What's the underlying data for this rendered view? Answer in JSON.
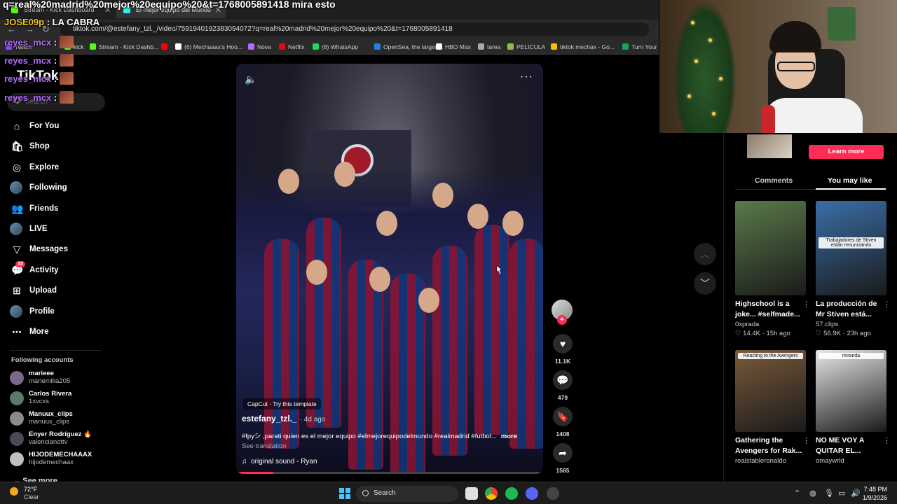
{
  "browser": {
    "tabs": [
      {
        "label": "Stream - Kick Dashboard",
        "color": "#53fc18"
      },
      {
        "label": "El mejor equipo del Mundo",
        "color": "#25f4ee"
      }
    ],
    "url": "tiktok.com/@estefany_tzl._/video/7591940192383094072?q=real%20madrid%20mejor%20equipo%20&t=1768005891418",
    "bookmarks": [
      {
        "label": "Twitch",
        "color": "#9146ff"
      },
      {
        "label": "kick",
        "color": "#53fc18"
      },
      {
        "label": "Stream - Kick Dashb...",
        "color": "#53fc18"
      },
      {
        "label": "",
        "color": "#ff0000"
      },
      {
        "label": "(6) Mechaaax's Hoo...",
        "color": "#ffffff"
      },
      {
        "label": "Nova",
        "color": "#b36bff"
      },
      {
        "label": "Netflix",
        "color": "#e50914"
      },
      {
        "label": "(8) WhatsApp",
        "color": "#25d366"
      },
      {
        "label": "OpenSea, the larges...",
        "color": "#2081e2"
      },
      {
        "label": "HBO Max",
        "color": "#ffffff"
      },
      {
        "label": "tarea",
        "color": "#aaaaaa"
      },
      {
        "label": "PELICULA",
        "color": "#8bc34a"
      },
      {
        "label": "tiktok mechax - Go...",
        "color": "#fbbc04"
      },
      {
        "label": "Turn Your S",
        "color": "#0fa958"
      }
    ]
  },
  "overlay": {
    "title": "q=real%20madrid%20mejor%20equipo%20&t=1768005891418 mira esto",
    "chat": [
      {
        "user": "JOSE09p",
        "msg": ": LA CABRA",
        "gold": true
      },
      {
        "user": "reyes_mcx",
        "msg": ":",
        "gold": false
      },
      {
        "user": "reyes_mcx",
        "msg": ":",
        "gold": false
      },
      {
        "user": "reyes_mcx",
        "msg": ":",
        "gold": false
      },
      {
        "user": "reyes_mcx",
        "msg": ":",
        "gold": false
      }
    ]
  },
  "tiktok": {
    "logo": "TikTok",
    "search_placeholder": "Search",
    "nav": [
      {
        "label": "For You",
        "icon": "home-icon",
        "glyph": "⌂"
      },
      {
        "label": "Shop",
        "icon": "shop-icon",
        "glyph": "🛍"
      },
      {
        "label": "Explore",
        "icon": "compass-icon",
        "glyph": "◎"
      },
      {
        "label": "Following",
        "icon": "following-avatar-icon",
        "glyph": ""
      },
      {
        "label": "Friends",
        "icon": "friends-icon",
        "glyph": "👥"
      },
      {
        "label": "LIVE",
        "icon": "live-avatar-icon",
        "glyph": ""
      },
      {
        "label": "Messages",
        "icon": "messages-icon",
        "glyph": "▽"
      },
      {
        "label": "Activity",
        "icon": "activity-icon",
        "glyph": "💬",
        "badge": "33"
      },
      {
        "label": "Upload",
        "icon": "upload-icon",
        "glyph": "⊞"
      },
      {
        "label": "Profile",
        "icon": "profile-avatar-icon",
        "glyph": ""
      },
      {
        "label": "More",
        "icon": "more-icon",
        "glyph": "⋯"
      }
    ],
    "following_title": "Following accounts",
    "following": [
      {
        "name": "marieee",
        "handle": "mariemilia205"
      },
      {
        "name": "Carlos Rivera",
        "handle": "1xvcxs"
      },
      {
        "name": "Manuux_clips",
        "handle": "manuux_clips"
      },
      {
        "name": "Enyer Rodríguez 🔥",
        "handle": "valencianottv"
      },
      {
        "name": "HIJODEMECHAAAX",
        "handle": "hijodemechaax"
      }
    ],
    "see_more": "See more"
  },
  "video": {
    "capcut": "CapCut · Try this template",
    "author": "estefany_tzl._",
    "age": "· 4d ago",
    "caption": "#fpyシ ,parati quien es el mejor equipo #elmejorequipodelmundo #realmadrid #futbol...",
    "more": "more",
    "see_translation": "See translation",
    "sound": "original sound - Ryan",
    "progress": 0.12,
    "likes": "11.1K",
    "comments": "479",
    "saves": "1408",
    "shares": "1565"
  },
  "right_panel": {
    "learn_more": "Learn more",
    "tabs": [
      "Comments",
      "You may like"
    ],
    "cards": [
      {
        "title": "Highschool is a joke... #selfmade...",
        "user": "0xprada",
        "likes": "14.4K",
        "age": "15h ago",
        "thumb": "#5a7a4a"
      },
      {
        "title": "La producción de Mr Stiven está...",
        "user": "57.clips",
        "likes": "56.9K",
        "age": "23h ago",
        "thumb": "#3a6ea8",
        "overlay_text": "Trabajadores de Stiven están renunciando"
      },
      {
        "title": "Gathering the Avengers for Rak...",
        "user": "realstableronaldo",
        "likes": "",
        "age": "",
        "thumb": "#7a5a3a",
        "overlay_text": "Reacting to the Avengers"
      },
      {
        "title": "NO ME VOY A QUITAR EL...",
        "user": "omaywrld",
        "likes": "",
        "age": "",
        "thumb": "#e8e8e8",
        "overlay_text": "miranda"
      }
    ]
  },
  "taskbar": {
    "temp": "72°F",
    "condition": "Clear",
    "search": "Search",
    "time": "7:48 PM",
    "date": "1/9/2026"
  }
}
